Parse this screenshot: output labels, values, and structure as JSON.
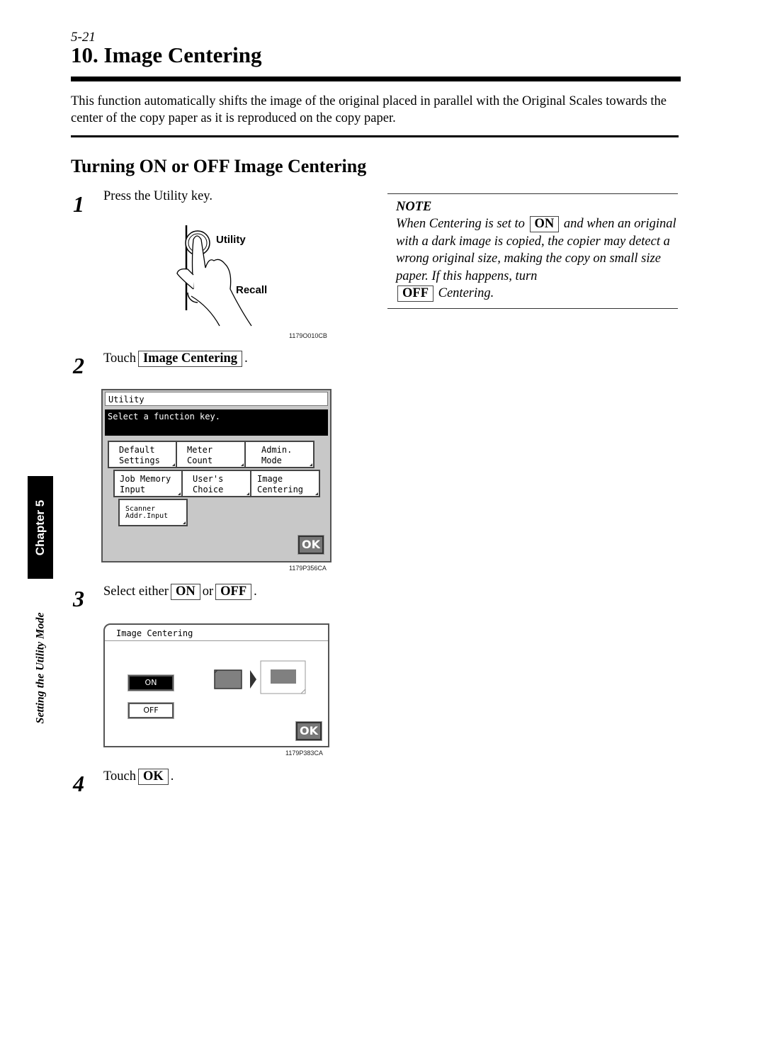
{
  "page": {
    "page_number": "5-21",
    "title": "10. Image Centering",
    "intro": "This function automatically shifts the image of the original placed in parallel with the Original Scales towards the center of the copy paper as it is reproduced on the copy paper.",
    "subtitle": "Turning ON or OFF Image Centering"
  },
  "side": {
    "chapter_tab": "Chapter 5",
    "section_label": "Setting the Utility Mode"
  },
  "note": {
    "title": "NOTE",
    "text_1": "When Centering is set to",
    "key_on": "ON",
    "text_2": "and when an original with a dark image is copied, the copier may detect a wrong original size, making the copy on small size paper. If this happens, turn",
    "key_off": "OFF",
    "text_3": "Centering."
  },
  "steps": [
    {
      "number": "1",
      "text": "Press the Utility key.",
      "figure": {
        "label_utility": "Utility",
        "label_recall": "Recall",
        "code": "1179O010CB"
      }
    },
    {
      "number": "2",
      "prefix": "Touch",
      "key": "Image Centering",
      "suffix": ".",
      "screen": {
        "title": "Utility",
        "message": "Select a function key.",
        "keys": [
          "Default\nSettings",
          "Meter\nCount",
          "Admin.\nMode",
          "Job Memory\nInput",
          "User's\nChoice",
          "Image\nCentering",
          "Scanner\nAddr.Input"
        ],
        "ok_label": "OK",
        "code": "1179P356CA"
      }
    },
    {
      "number": "3",
      "prefix": "Select either",
      "key_on": "ON",
      "middle": "or",
      "key_off": "OFF",
      "suffix": ".",
      "screen": {
        "title": "Image Centering",
        "on_label": "ON",
        "off_label": "OFF",
        "selected": "ON",
        "ok_label": "OK",
        "code": "1179P383CA"
      }
    },
    {
      "number": "4",
      "prefix": "Touch",
      "key": "OK",
      "suffix": "."
    }
  ],
  "icons": {
    "hand": "hand-pressing-key-icon",
    "centering": "image-centering-diagram-icon"
  }
}
